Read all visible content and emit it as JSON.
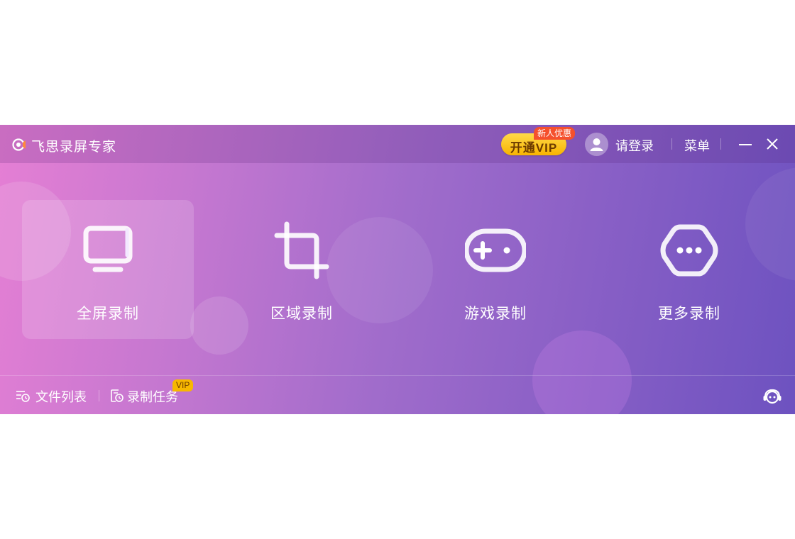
{
  "app": {
    "title": "飞思录屏专家"
  },
  "header": {
    "vip_button": "开通VIP",
    "promo_badge": "新人优惠",
    "login": "请登录",
    "menu": "菜单"
  },
  "modes": [
    {
      "label": "全屏录制",
      "icon": "monitor-icon",
      "selected": true
    },
    {
      "label": "区域录制",
      "icon": "crop-icon",
      "selected": false
    },
    {
      "label": "游戏录制",
      "icon": "gamepad-icon",
      "selected": false
    },
    {
      "label": "更多录制",
      "icon": "more-chat-icon",
      "selected": false
    }
  ],
  "footer": {
    "file_list": "文件列表",
    "record_tasks": "录制任务",
    "vip_tag": "VIP"
  },
  "colors": {
    "accent_yellow": "#f8b400",
    "promo_red": "#f5502d",
    "gradient_start": "#e57fd4",
    "gradient_end": "#6d52c0"
  }
}
